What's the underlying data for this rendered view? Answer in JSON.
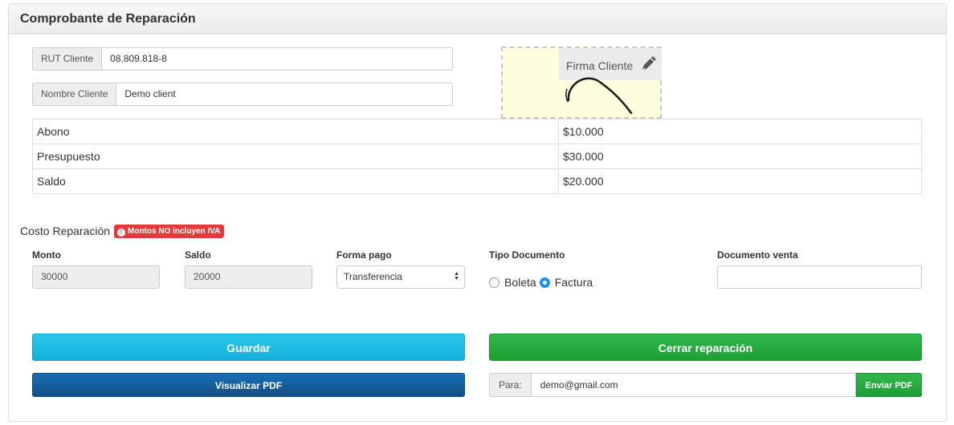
{
  "panel": {
    "title": "Comprobante de Reparación"
  },
  "client": {
    "rut_label": "RUT Cliente",
    "rut_value": "08.809.818-8",
    "name_label": "Nombre Cliente",
    "name_value": "Demo client"
  },
  "signature": {
    "label": "Firma Cliente",
    "icon": "pen-icon"
  },
  "summary": [
    {
      "label": "Abono",
      "value": "$10.000"
    },
    {
      "label": "Presupuesto",
      "value": "$30.000"
    },
    {
      "label": "Saldo",
      "value": "$20.000"
    }
  ],
  "costo": {
    "label": "Costo Reparación",
    "badge": "Montos NO incluyen IVA",
    "badge_color": "#e33b3b"
  },
  "form": {
    "monto_label": "Monto",
    "monto_value": "30000",
    "saldo_label": "Saldo",
    "saldo_value": "20000",
    "forma_pago_label": "Forma pago",
    "forma_pago_value": "Transferencia",
    "tipo_documento_label": "Tipo Documento",
    "tipo_options": [
      {
        "label": "Boleta",
        "checked": false
      },
      {
        "label": "Factura",
        "checked": true
      }
    ],
    "documento_venta_label": "Documento venta",
    "documento_venta_value": ""
  },
  "actions": {
    "guardar": "Guardar",
    "cerrar": "Cerrar reparación",
    "visualizar_pdf": "Visualizar PDF",
    "para_label": "Para:",
    "email_value": "demo@gmail.com",
    "enviar_pdf": "Enviar PDF"
  },
  "colors": {
    "guardar": "#12b0d8",
    "cerrar": "#1e9f35",
    "visualizar": "#104f86",
    "radio_checked": "#1e8ef8"
  }
}
